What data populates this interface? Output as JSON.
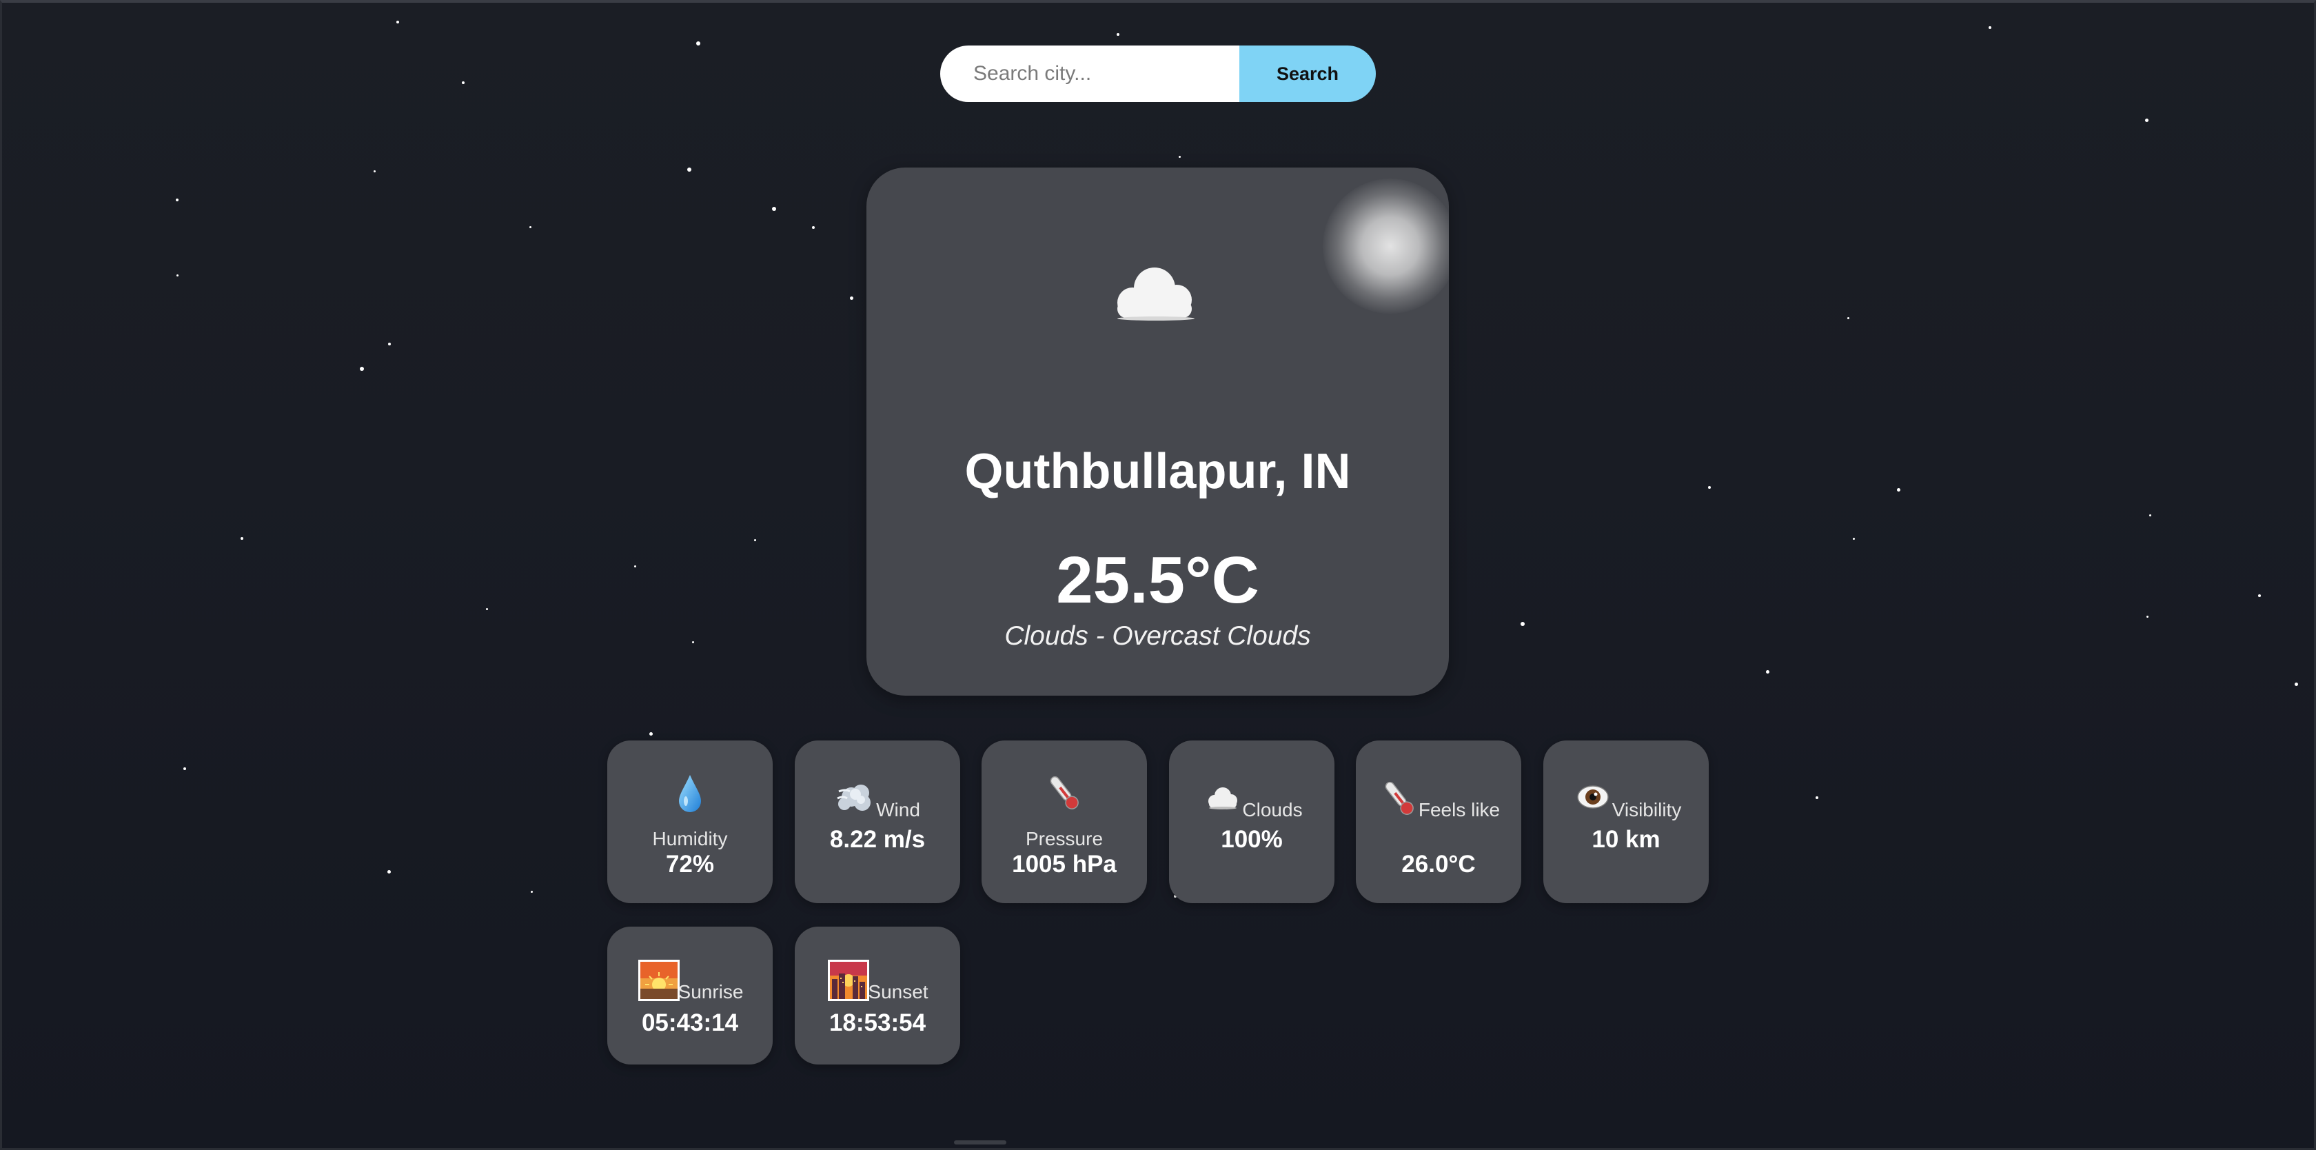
{
  "search": {
    "placeholder": "Search city...",
    "button_label": "Search"
  },
  "current": {
    "icon": "cloud-icon",
    "city": "Quthbullapur, IN",
    "temperature": "25.5°C",
    "description": "Clouds - Overcast Clouds"
  },
  "details": [
    {
      "icon": "droplet-icon",
      "label": "Humidity",
      "value": "72%"
    },
    {
      "icon": "wind-icon",
      "label": "Wind",
      "value": "8.22 m/s"
    },
    {
      "icon": "thermometer-icon",
      "label": "Pressure",
      "value": "1005 hPa"
    },
    {
      "icon": "cloud-icon",
      "label": "Clouds",
      "value": "100%"
    },
    {
      "icon": "thermometer-icon",
      "label": "Feels like",
      "value": "26.0°C"
    },
    {
      "icon": "eye-icon",
      "label": "Visibility",
      "value": "10 km"
    },
    {
      "icon": "sunrise-icon",
      "label": "Sunrise",
      "value": "05:43:14"
    },
    {
      "icon": "sunset-icon",
      "label": "Sunset",
      "value": "18:53:54"
    }
  ],
  "colors": {
    "background": "#1b1e25",
    "card": "#46484e",
    "tile": "#4a4c52",
    "accent": "#7fd3f5"
  }
}
